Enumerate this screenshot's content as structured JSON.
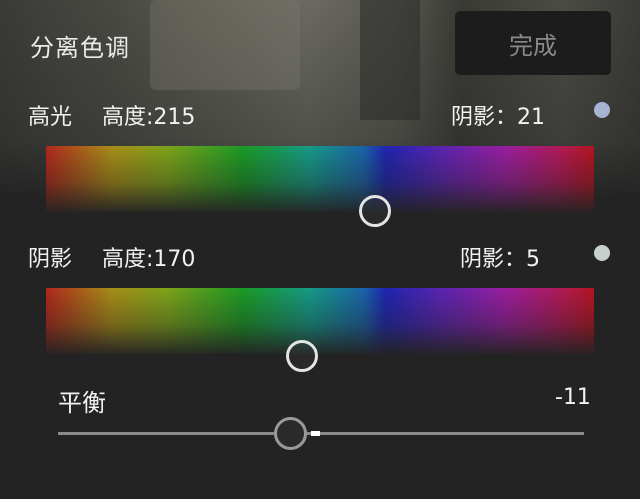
{
  "panel": {
    "title": "分离色调",
    "done_label": "完成"
  },
  "highlights": {
    "label": "高光",
    "hue_text": "高度:215",
    "saturation_text": "阴影：21",
    "swatch_color": "#a8b4d4"
  },
  "shadows": {
    "label": "阴影",
    "hue_text": "高度:170",
    "saturation_text": "阴影：5",
    "swatch_color": "#c8d0cc"
  },
  "balance": {
    "label": "平衡",
    "value_text": "-11"
  }
}
